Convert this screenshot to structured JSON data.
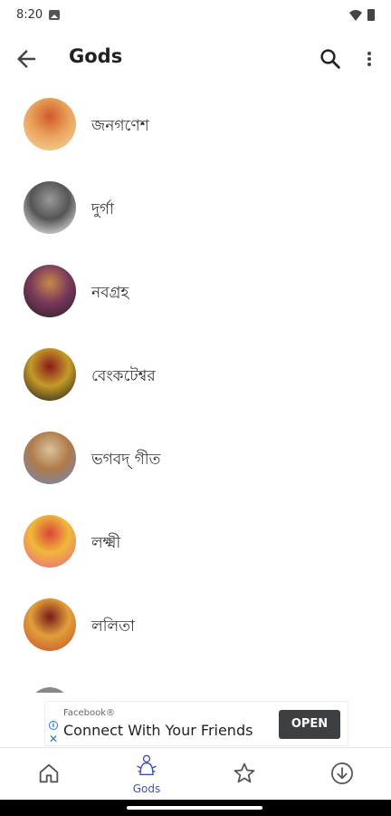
{
  "status_bar": {
    "time": "8:20"
  },
  "app_bar": {
    "title": "Gods"
  },
  "list": {
    "items": [
      {
        "label": "জনগণেশ",
        "icon": "ganesha-image",
        "colors": [
          "#f7d9a8",
          "#e8a25a",
          "#d05a2a"
        ]
      },
      {
        "label": "দুর্গা",
        "icon": "durga-sketch-image",
        "colors": [
          "#ffffff",
          "#555555",
          "#999999"
        ]
      },
      {
        "label": "নবগ্রহ",
        "icon": "navagraha-grid-image",
        "colors": [
          "#2a1a2a",
          "#7a3a5a",
          "#c9894a"
        ]
      },
      {
        "label": "বেংকটেশ্বর",
        "icon": "venkateswara-image",
        "colors": [
          "#1a1a1a",
          "#c59a2a",
          "#8a1a1a"
        ]
      },
      {
        "label": "ভগবদ্ গীত",
        "icon": "bhagavad-gita-image",
        "colors": [
          "#6a8ac0",
          "#b07a4a",
          "#d9c29a"
        ]
      },
      {
        "label": "লক্ষ্মী",
        "icon": "lakshmi-image",
        "colors": [
          "#e9608a",
          "#f0b83a",
          "#d9463a"
        ]
      },
      {
        "label": "ললিতা",
        "icon": "lalita-image",
        "colors": [
          "#c94a2a",
          "#e0a03a",
          "#7a1a1a"
        ]
      }
    ]
  },
  "ad": {
    "source": "Facebook®",
    "title": "Connect With Your Friends",
    "cta": "OPEN"
  },
  "bottom_nav": {
    "items": [
      {
        "label": "",
        "icon": "home-icon"
      },
      {
        "label": "Gods",
        "icon": "gods-icon"
      },
      {
        "label": "",
        "icon": "star-icon"
      },
      {
        "label": "",
        "icon": "download-icon"
      }
    ]
  }
}
